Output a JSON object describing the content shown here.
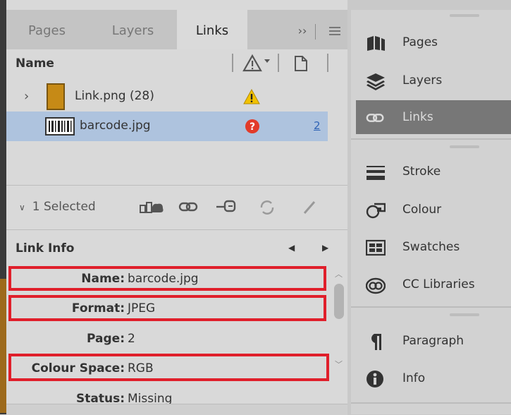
{
  "tabs": [
    {
      "label": "Pages"
    },
    {
      "label": "Layers"
    },
    {
      "label": "Links"
    }
  ],
  "tab_overflow": "››",
  "table_header": {
    "name": "Name"
  },
  "links": [
    {
      "name": "Link.png (28)",
      "status": "warning",
      "page": ""
    },
    {
      "name": "barcode.jpg",
      "status": "missing",
      "page": "2"
    }
  ],
  "selection": {
    "label": "1 Selected"
  },
  "link_info": {
    "title": "Link Info",
    "fields": [
      {
        "label": "Name:",
        "value": "barcode.jpg",
        "highlighted": true
      },
      {
        "label": "Format:",
        "value": "JPEG",
        "highlighted": true
      },
      {
        "label": "Page:",
        "value": "2",
        "highlighted": false
      },
      {
        "label": "Colour Space:",
        "value": "RGB",
        "highlighted": true
      },
      {
        "label": "Status:",
        "value": "Missing",
        "highlighted": false
      }
    ]
  },
  "dock": {
    "groups": [
      [
        {
          "label": "Pages",
          "icon": "pages-icon"
        },
        {
          "label": "Layers",
          "icon": "layers-icon"
        },
        {
          "label": "Links",
          "icon": "links-icon",
          "active": true
        }
      ],
      [
        {
          "label": "Stroke",
          "icon": "stroke-icon"
        },
        {
          "label": "Colour",
          "icon": "colour-icon"
        },
        {
          "label": "Swatches",
          "icon": "swatches-icon"
        },
        {
          "label": "CC Libraries",
          "icon": "cc-libraries-icon"
        }
      ],
      [
        {
          "label": "Paragraph",
          "icon": "paragraph-icon"
        },
        {
          "label": "Info",
          "icon": "info-icon"
        }
      ]
    ]
  },
  "colors": {
    "highlight": "#e01f2b",
    "selected_row": "#aec3de",
    "warning": "#f2c200",
    "missing": "#e23b2a",
    "active_dock": "#777777"
  }
}
